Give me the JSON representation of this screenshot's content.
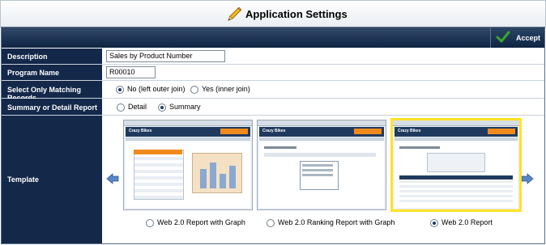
{
  "header": {
    "title": "Application Settings",
    "icon": "pencil-icon"
  },
  "toolbar": {
    "accept_label": "Accept",
    "accept_icon": "checkmark-icon"
  },
  "colors": {
    "label_bg": "#14284a",
    "toolbar_bg": "#0f2443",
    "selected_border": "#ffe227",
    "accent_orange": "#f08a1c",
    "check_green": "#3aa62e"
  },
  "form": {
    "description": {
      "label": "Description",
      "value": "Sales by Product Number"
    },
    "program_name": {
      "label": "Program Name",
      "value": "R00010"
    },
    "matching": {
      "label": "Select Only Matching Records",
      "options": [
        "No (left outer join)",
        "Yes (inner join)"
      ],
      "selected": 0
    },
    "summary_detail": {
      "label": "Summary or Detail Report",
      "options": [
        "Detail",
        "Summary"
      ],
      "selected": 1
    },
    "template": {
      "label": "Template",
      "options": [
        {
          "caption": "Web 2.0 Report with Graph",
          "brand": "Crazy Bikes",
          "selected": false
        },
        {
          "caption": "Web 2.0 Ranking Report with Graph",
          "brand": "Crazy Bikes",
          "selected": false
        },
        {
          "caption": "Web 2.0 Report",
          "brand": "Crazy Bikes",
          "selected": true
        }
      ],
      "prev_icon": "arrow-left-icon",
      "next_icon": "arrow-right-icon"
    }
  }
}
